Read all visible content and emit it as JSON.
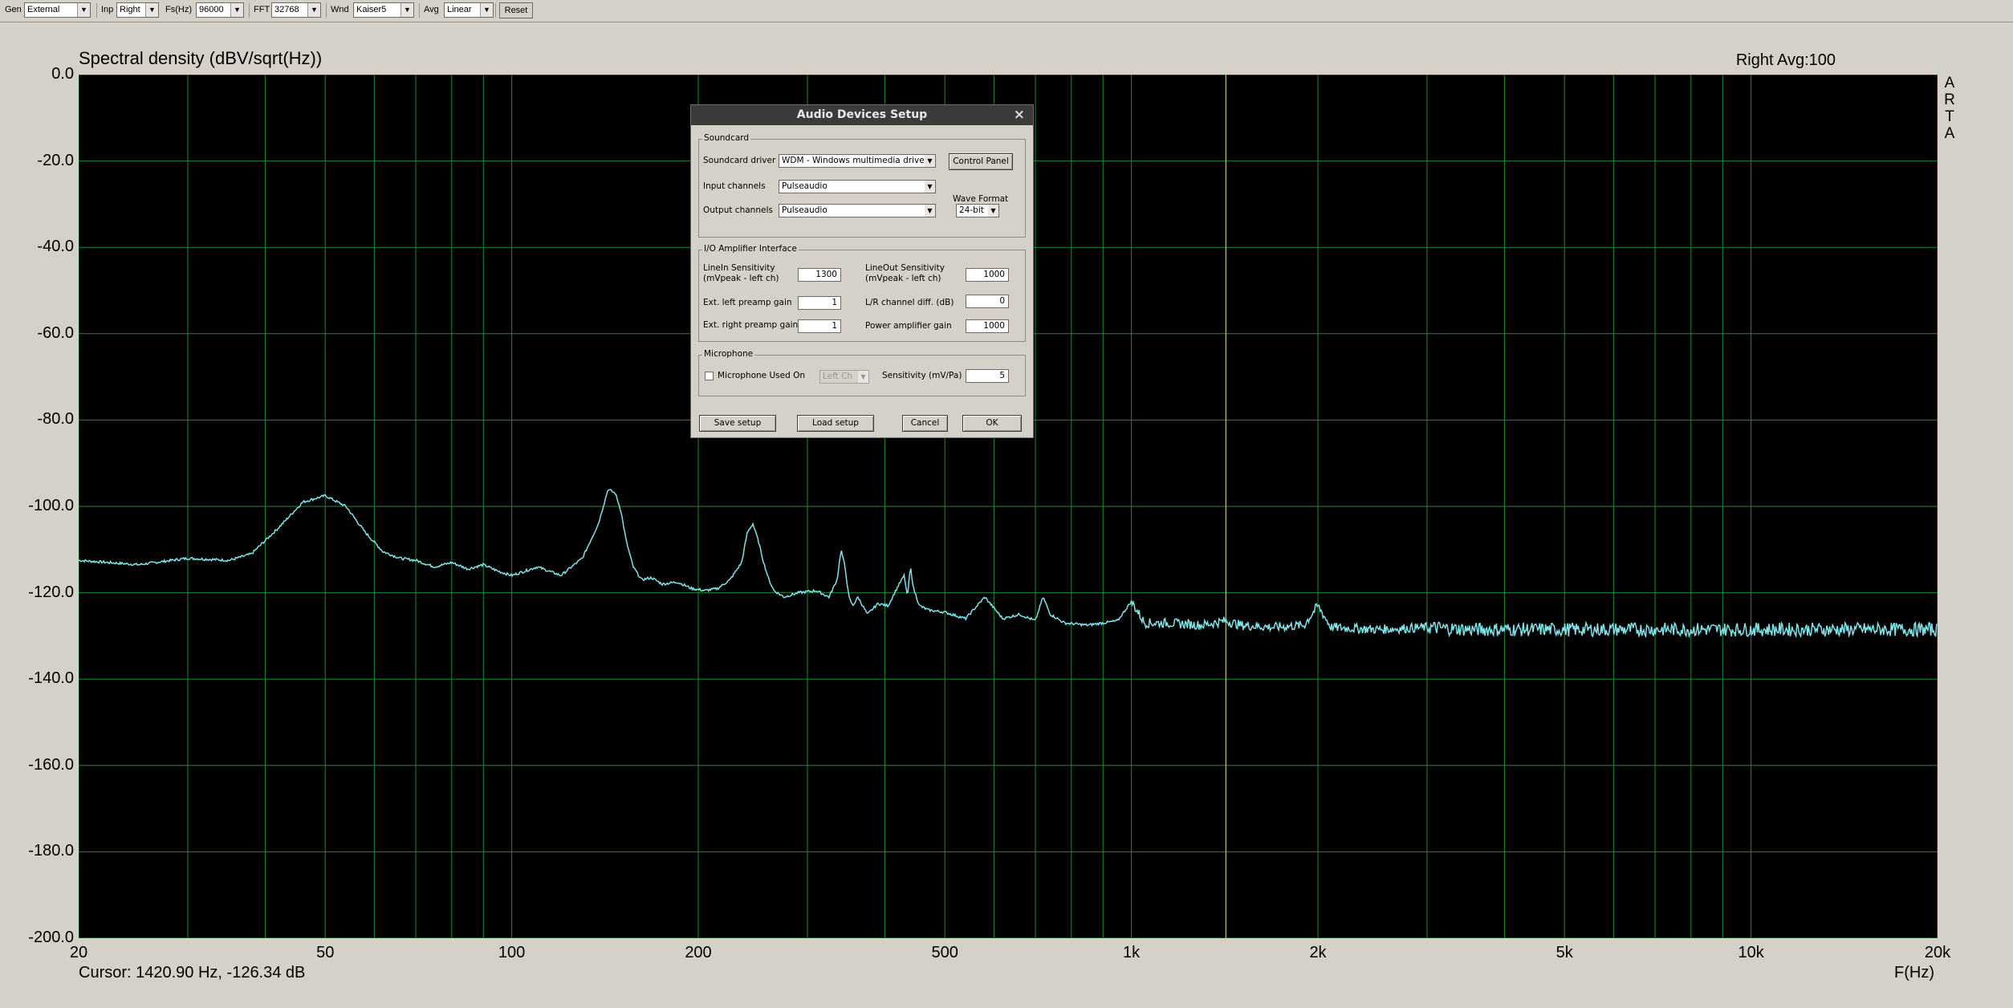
{
  "toolbar": {
    "gen_label": "Gen",
    "gen_value": "External",
    "inp_label": "Inp",
    "inp_value": "Right",
    "fs_label": "Fs(Hz)",
    "fs_value": "96000",
    "fft_label": "FFT",
    "fft_value": "32768",
    "wnd_label": "Wnd",
    "wnd_value": "Kaiser5",
    "avg_label": "Avg",
    "avg_value": "Linear",
    "reset_label": "Reset"
  },
  "plot": {
    "title": "Spectral density (dBV/sqrt(Hz))",
    "channel_info": "Right  Avg:100",
    "side_letters": [
      "A",
      "R",
      "T",
      "A"
    ],
    "cursor_readout": "Cursor: 1420.90 Hz, -126.34 dB",
    "x_axis_label": "F(Hz)",
    "cursor_freq_hz": 1420.9,
    "background": "#000000",
    "grid_color": "#1f8a2e",
    "trace_color": "#7fe3e8",
    "cursor_color": "#c8c800"
  },
  "chart_data": {
    "type": "line",
    "title": "Spectral density (dBV/sqrt(Hz))",
    "xlabel": "F(Hz)",
    "ylabel": "",
    "x_scale": "log",
    "xlim": [
      20,
      20000
    ],
    "ylim": [
      -200,
      0
    ],
    "grid": true,
    "y_ticks": [
      "0.0",
      "-20.0",
      "-40.0",
      "-60.0",
      "-80.0",
      "-100.0",
      "-120.0",
      "-140.0",
      "-160.0",
      "-180.0",
      "-200.0"
    ],
    "x_ticks": [
      {
        "value": 20,
        "label": "20"
      },
      {
        "value": 50,
        "label": "50"
      },
      {
        "value": 100,
        "label": "100"
      },
      {
        "value": 200,
        "label": "200"
      },
      {
        "value": 500,
        "label": "500"
      },
      {
        "value": 1000,
        "label": "1k"
      },
      {
        "value": 2000,
        "label": "2k"
      },
      {
        "value": 5000,
        "label": "5k"
      },
      {
        "value": 10000,
        "label": "10k"
      },
      {
        "value": 20000,
        "label": "20k"
      }
    ],
    "series": [
      {
        "x": [
          20,
          25,
          30,
          35,
          38,
          42,
          46,
          50,
          54,
          58,
          62,
          66,
          70,
          75,
          80,
          85,
          90,
          95,
          100,
          110,
          120,
          130,
          138,
          143,
          147,
          150,
          153,
          157,
          162,
          168,
          175,
          185,
          195,
          205,
          215,
          225,
          235,
          240,
          245,
          250,
          255,
          260,
          265,
          275,
          290,
          310,
          325,
          335,
          340,
          345,
          350,
          355,
          362,
          375,
          390,
          405,
          420,
          430,
          435,
          440,
          445,
          455,
          470,
          500,
          540,
          580,
          620,
          660,
          700,
          720,
          740,
          780,
          850,
          950,
          1000,
          1050,
          1150,
          1300,
          1420,
          1500,
          1700,
          1900,
          2000,
          2100,
          2500,
          3000,
          3500,
          4000,
          5000,
          7000,
          10000,
          14000,
          20000
        ],
        "y": [
          -112.5,
          -113.5,
          -112,
          -112.5,
          -111,
          -105,
          -99,
          -97.5,
          -100,
          -106,
          -110.5,
          -112,
          -112.5,
          -114,
          -113,
          -114.5,
          -113.5,
          -115,
          -116,
          -114,
          -116,
          -112,
          -104,
          -96,
          -97,
          -101,
          -108,
          -114,
          -117,
          -116.5,
          -118,
          -117.5,
          -119,
          -119.5,
          -119,
          -117,
          -113,
          -106,
          -104,
          -108,
          -113,
          -117,
          -119.5,
          -121,
          -120,
          -119.5,
          -121,
          -117,
          -110,
          -114,
          -121,
          -123,
          -121,
          -125,
          -122.5,
          -123,
          -118.5,
          -116,
          -121,
          -114,
          -119,
          -123,
          -124,
          -124.5,
          -126,
          -121,
          -126,
          -125,
          -126.5,
          -121,
          -125,
          -127,
          -127.5,
          -126.5,
          -122,
          -127,
          -127,
          -127.5,
          -126.5,
          -127.5,
          -128,
          -127.5,
          -123,
          -128,
          -128.5,
          -128,
          -128.5,
          -128.5,
          -128.5,
          -128.5,
          -128.5,
          -128.5,
          -128.5
        ]
      }
    ]
  },
  "dialog": {
    "title": "Audio Devices Setup",
    "close_glyph": "×",
    "soundcard": {
      "group_title": "Soundcard",
      "driver_label": "Soundcard driver",
      "driver_value": "WDM - Windows multimedia driver",
      "control_panel_label": "Control Panel",
      "input_label": "Input channels",
      "input_value": "Pulseaudio",
      "output_label": "Output channels",
      "output_value": "Pulseaudio",
      "wave_format_label": "Wave Format",
      "wave_format_value": "24-bit"
    },
    "io": {
      "group_title": "I/O Amplifier Interface",
      "linein_label_1": "LineIn Sensitivity",
      "linein_label_2": "(mVpeak - left ch)",
      "linein_value": "1300",
      "lineout_label_1": "LineOut Sensitivity",
      "lineout_label_2": "(mVpeak - left ch)",
      "lineout_value": "1000",
      "ext_left_label": "Ext. left preamp gain",
      "ext_left_value": "1",
      "lr_diff_label": "L/R channel diff. (dB)",
      "lr_diff_value": "0",
      "ext_right_label": "Ext. right preamp gain",
      "ext_right_value": "1",
      "power_amp_label": "Power amplifier gain",
      "power_amp_value": "1000"
    },
    "microphone": {
      "group_title": "Microphone",
      "used_on_label": "Microphone Used On",
      "used_on_checked": false,
      "channel_value": "Left Ch",
      "sensitivity_label": "Sensitivity (mV/Pa)",
      "sensitivity_value": "5"
    },
    "buttons": {
      "save": "Save setup",
      "load": "Load setup",
      "cancel": "Cancel",
      "ok": "OK"
    }
  }
}
